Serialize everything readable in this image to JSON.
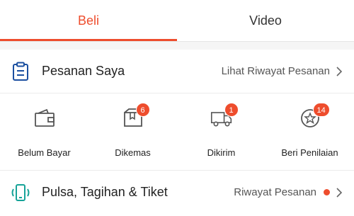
{
  "tabs": [
    {
      "label": "Beli",
      "active": true
    },
    {
      "label": "Video",
      "active": false
    }
  ],
  "orders": {
    "icon": "clipboard-icon",
    "title": "Pesanan Saya",
    "link_label": "Lihat Riwayat Pesanan"
  },
  "statuses": [
    {
      "label": "Belum Bayar",
      "icon": "wallet-icon",
      "badge": ""
    },
    {
      "label": "Dikemas",
      "icon": "box-icon",
      "badge": "6"
    },
    {
      "label": "Dikirim",
      "icon": "truck-icon",
      "badge": "1"
    },
    {
      "label": "Beri Penilaian",
      "icon": "star-review-icon",
      "badge": "14"
    }
  ],
  "pulsa": {
    "icon": "phone-signal-icon",
    "title": "Pulsa, Tagihan & Tiket",
    "link_label": "Riwayat Pesanan"
  },
  "colors": {
    "accent": "#ee4d2d",
    "order_icon": "#1b4fa0",
    "pulsa_icon": "#17a398"
  }
}
